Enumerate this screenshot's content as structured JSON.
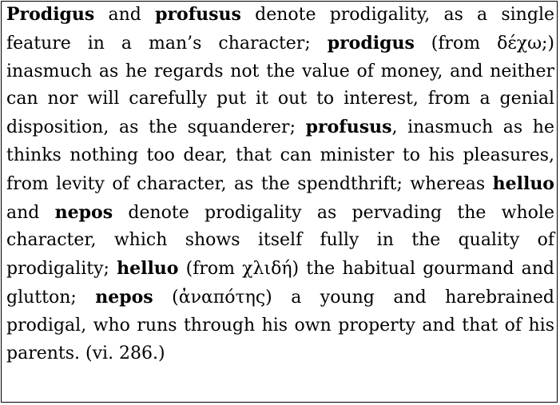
{
  "document": {
    "segments": [
      {
        "text": "Prodigus",
        "bold": true
      },
      {
        "text": " and ",
        "bold": false
      },
      {
        "text": "profusus",
        "bold": true
      },
      {
        "text": " denote prodigality, as a single feature in a man’s character; ",
        "bold": false
      },
      {
        "text": "prodigus",
        "bold": true
      },
      {
        "text": " (from δέχω;) inasmuch as he regards not the value of money, and neither can nor will carefully put it out to interest, from a genial disposition, as the squanderer; ",
        "bold": false
      },
      {
        "text": "profusus",
        "bold": true
      },
      {
        "text": ", inasmuch as he thinks nothing too dear, that can minister to his pleasures, from levity of character, as the spendthrift; whereas ",
        "bold": false
      },
      {
        "text": "helluo",
        "bold": true
      },
      {
        "text": " and ",
        "bold": false
      },
      {
        "text": "nepos",
        "bold": true
      },
      {
        "text": " denote prodigality as pervading the whole character, which shows itself fully in the quality of prodigality; ",
        "bold": false
      },
      {
        "text": "helluo",
        "bold": true
      },
      {
        "text": " (from χλιδή) the habitual gourmand and glutton; ",
        "bold": false
      },
      {
        "text": "nepos",
        "bold": true
      },
      {
        "text": " (ἀναπότης) a young and harebrained prodigal, who runs through his own property and that of his parents.  (vi. 286.)",
        "bold": false
      }
    ]
  }
}
